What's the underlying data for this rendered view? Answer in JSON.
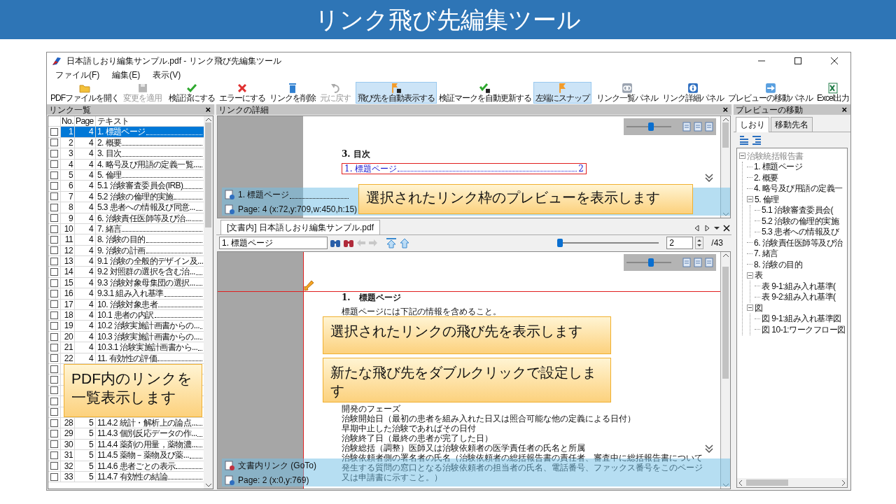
{
  "slide_title": "リンク飛び先編集ツール",
  "window": {
    "title": "日本語しおり編集サンプル.pdf - リンク飛び先編集ツール"
  },
  "menu": [
    "ファイル(F)",
    "編集(E)",
    "表示(V)"
  ],
  "toolbar": {
    "groups": [
      [
        {
          "label": "PDFファイルを開く",
          "disabled": false,
          "pressed": false
        },
        {
          "label": "変更を適用",
          "disabled": true,
          "pressed": false
        }
      ],
      [
        {
          "label": "検証済にする",
          "disabled": false,
          "pressed": false
        },
        {
          "label": "エラーにする",
          "disabled": false,
          "pressed": false
        },
        {
          "label": "リンクを削除",
          "disabled": false,
          "pressed": false
        },
        {
          "label": "元に戻す",
          "disabled": true,
          "pressed": false
        }
      ],
      [
        {
          "label": "飛び先を自動表示する",
          "disabled": false,
          "pressed": true
        },
        {
          "label": "検証マークを自動更新する",
          "disabled": false,
          "pressed": false
        },
        {
          "label": "左端にスナップ",
          "disabled": false,
          "pressed": true
        }
      ],
      [
        {
          "label": "リンク一覧パネル",
          "disabled": false,
          "pressed": false
        },
        {
          "label": "リンク詳細パネル",
          "disabled": false,
          "pressed": false
        },
        {
          "label": "プレビューの移動パネル",
          "disabled": false,
          "pressed": false
        }
      ]
    ],
    "right": [
      {
        "label": "Excel出力",
        "disabled": false,
        "pressed": false
      }
    ]
  },
  "link_list": {
    "title": "リンク一覧",
    "close": "×",
    "columns": [
      "No.",
      "Page",
      "テキスト"
    ],
    "callout": "PDF内のリンクを一覧表示します",
    "rows": [
      {
        "no": "1",
        "page": "4",
        "text": "1. 標題ページ",
        "checked": false,
        "selected": true
      },
      {
        "no": "2",
        "page": "4",
        "text": "2. 概要",
        "checked": false,
        "selected": false
      },
      {
        "no": "3",
        "page": "4",
        "text": "3. 目次",
        "checked": false,
        "selected": false
      },
      {
        "no": "4",
        "page": "4",
        "text": "4. 略号及び用語の定義一覧...",
        "checked": false,
        "selected": false
      },
      {
        "no": "5",
        "page": "4",
        "text": "5. 倫理",
        "checked": false,
        "selected": false
      },
      {
        "no": "6",
        "page": "4",
        "text": "5.1 治験審査委員会(IRB)",
        "checked": false,
        "selected": false
      },
      {
        "no": "7",
        "page": "4",
        "text": "5.2 治験の倫理的実施",
        "checked": false,
        "selected": false
      },
      {
        "no": "8",
        "page": "4",
        "text": "5.3 患者への情報及び同意...",
        "checked": false,
        "selected": false
      },
      {
        "no": "9",
        "page": "4",
        "text": "6. 治験責任医師等及び治...",
        "checked": false,
        "selected": false
      },
      {
        "no": "10",
        "page": "4",
        "text": "7. 緒言",
        "checked": false,
        "selected": false
      },
      {
        "no": "11",
        "page": "4",
        "text": "8. 治験の目的",
        "checked": false,
        "selected": false
      },
      {
        "no": "12",
        "page": "4",
        "text": "9. 治験の計画",
        "checked": false,
        "selected": false
      },
      {
        "no": "13",
        "page": "4",
        "text": "9.1 治験の全般的デザイン及...",
        "checked": false,
        "selected": false
      },
      {
        "no": "14",
        "page": "4",
        "text": "9.2 対照群の選択を含む治...",
        "checked": false,
        "selected": false
      },
      {
        "no": "15",
        "page": "4",
        "text": "9.3 治験対象母集団の選択...",
        "checked": false,
        "selected": false
      },
      {
        "no": "16",
        "page": "4",
        "text": "9.3.1 組み入れ基準",
        "checked": false,
        "selected": false
      },
      {
        "no": "17",
        "page": "4",
        "text": "10. 治験対象患者",
        "checked": false,
        "selected": false
      },
      {
        "no": "18",
        "page": "4",
        "text": "10.1 患者の内訳",
        "checked": false,
        "selected": false
      },
      {
        "no": "19",
        "page": "4",
        "text": "10.2 治験実施計画書からの...",
        "checked": false,
        "selected": false
      },
      {
        "no": "20",
        "page": "4",
        "text": "10.3 治験実施計画書からの...",
        "checked": false,
        "selected": false
      },
      {
        "no": "21",
        "page": "4",
        "text": "10.3.1 治験実施計画書から...",
        "checked": false,
        "selected": false
      },
      {
        "no": "22",
        "page": "4",
        "text": "11. 有効性の評価",
        "checked": false,
        "selected": false
      },
      {
        "checked": false,
        "selected": false
      },
      {
        "checked": false,
        "selected": false
      },
      {
        "checked": false,
        "selected": false
      },
      {
        "checked": false,
        "selected": false
      },
      {
        "checked": false,
        "selected": false
      },
      {
        "no": "28",
        "page": "5",
        "text": "11.4.2 統計・解析上の論点...",
        "checked": false,
        "selected": false
      },
      {
        "no": "29",
        "page": "5",
        "text": "11.4.3 個別反応データの作...",
        "checked": false,
        "selected": false
      },
      {
        "no": "30",
        "page": "5",
        "text": "11.4.4 薬剤の用量，薬物濃...",
        "checked": false,
        "selected": false
      },
      {
        "no": "31",
        "page": "5",
        "text": "11.4.5 薬物－薬物及び薬...",
        "checked": false,
        "selected": false
      },
      {
        "no": "32",
        "page": "5",
        "text": "11.4.6 患者ごとの表示",
        "checked": false,
        "selected": false
      },
      {
        "no": "33",
        "page": "5",
        "text": "11.4.7 有効性の結論",
        "checked": false,
        "selected": false
      }
    ]
  },
  "link_detail": {
    "title": "リンクの詳細",
    "close": "×",
    "zoom": {
      "level": 0.55
    },
    "page": {
      "heading": "3. 目次",
      "entries": [
        {
          "text": "1. 標題ページ",
          "page": "2",
          "highlighted": true
        }
      ]
    },
    "info": {
      "link": "1. 標題ページ",
      "location": "Page: 4 (x:72,y:709,w:450,h:15)"
    },
    "callout": "選択されたリンク枠のプレビューを表示します"
  },
  "document_view": {
    "tab": "[文書内] 日本語しおり編集サンプル.pdf",
    "search": {
      "value": "1. 標題ページ"
    },
    "page_slider": {
      "level": 0.0
    },
    "page_number": "2",
    "page_count": "/43",
    "zoom": {
      "level": 0.55
    },
    "page": {
      "heading": "1.　標題ページ",
      "lines_top": [
        "標題ページには下記の情報を含めること。"
      ],
      "lines_bottom": [
        "開発のフェーズ",
        "治験開始日（最初の患者を組み入れた日又は照合可能な他の定義による日付）",
        "早期中止した治験であればその日付",
        "治験終了日（最終の患者が完了した日）",
        "治験総括（調整）医師又は治験依頼者の医学責任者の氏名と所属",
        "治験依頼者側の署名者の氏名（治験依頼者の総括報告書の責任者、審査中に総括報告書について",
        "発生する質問の窓口となる治験依頼者の担当者の氏名、電話番号、ファックス番号をこのページ",
        "又は申請書に示すこと。）"
      ]
    },
    "info": {
      "link": "文書内リンク (GoTo)",
      "location": "Page: 2 (x:0,y:769)"
    },
    "callouts": [
      "選択されたリンクの飛び先を表示します",
      "新たな飛び先をダブルクリックで設定します"
    ]
  },
  "navigation": {
    "title": "プレビューの移動",
    "close": "×",
    "tabs": [
      {
        "label": "しおり",
        "selected": true
      },
      {
        "label": "移動先名",
        "selected": false
      }
    ],
    "tree": [
      {
        "label": "治験統括報告書",
        "expanded": true,
        "children": [
          {
            "label": "1. 標題ページ"
          },
          {
            "label": "2. 概要"
          },
          {
            "label": "4. 略号及び用語の定義一"
          },
          {
            "label": "5. 倫理",
            "expanded": true,
            "children": [
              {
                "label": "5.1 治験審査委員会("
              },
              {
                "label": "5.2 治験の倫理的実施"
              },
              {
                "label": "5.3 患者への情報及び"
              }
            ]
          },
          {
            "label": "6. 治験責任医師等及び治"
          },
          {
            "label": "7. 緒言"
          },
          {
            "label": "8. 治験の目的"
          },
          {
            "label": "表",
            "expanded": true,
            "children": [
              {
                "label": "表 9-1:組み入れ基準("
              },
              {
                "label": "表 9-2:組み入れ基準("
              }
            ]
          },
          {
            "label": "図",
            "expanded": true,
            "children": [
              {
                "label": "図 9-1:組み入れ基準図"
              },
              {
                "label": "図 10-1:ワークフロー図"
              }
            ]
          }
        ]
      }
    ]
  }
}
